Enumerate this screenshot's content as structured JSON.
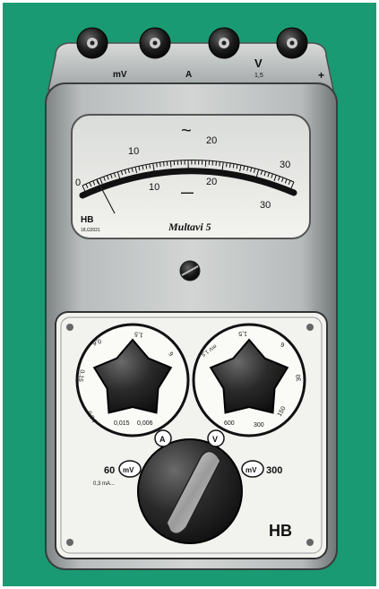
{
  "photo": {
    "background_color": "#1a9a72",
    "terminal_labels": [
      "mV",
      "A",
      "V",
      "1,5",
      "+"
    ],
    "meter": {
      "ac_symbol": "~",
      "ac_scale_labels": [
        "0",
        "10",
        "20",
        "30"
      ],
      "dc_symbol": "—",
      "dc_scale_labels": [
        "10",
        "20",
        "30"
      ],
      "maker_mark": "HB",
      "serial": "18,Ω2021",
      "model_name": "Multavi 5"
    },
    "left_dial": {
      "unit_badge": "A",
      "range_labels": [
        "0,015",
        "0,006",
        "0,04",
        "0,15",
        "0,6",
        "1,5",
        "6"
      ]
    },
    "right_dial": {
      "unit_badge": "V",
      "range_labels": [
        "600",
        "300",
        "150",
        "30",
        "6",
        "1,5",
        "mV 1,5"
      ]
    },
    "selector": {
      "left_badge": "mV",
      "left_value": "60",
      "left_note": "0,3 mA...",
      "right_badge": "mV",
      "right_value": "300"
    },
    "panel_logo": "HB"
  }
}
